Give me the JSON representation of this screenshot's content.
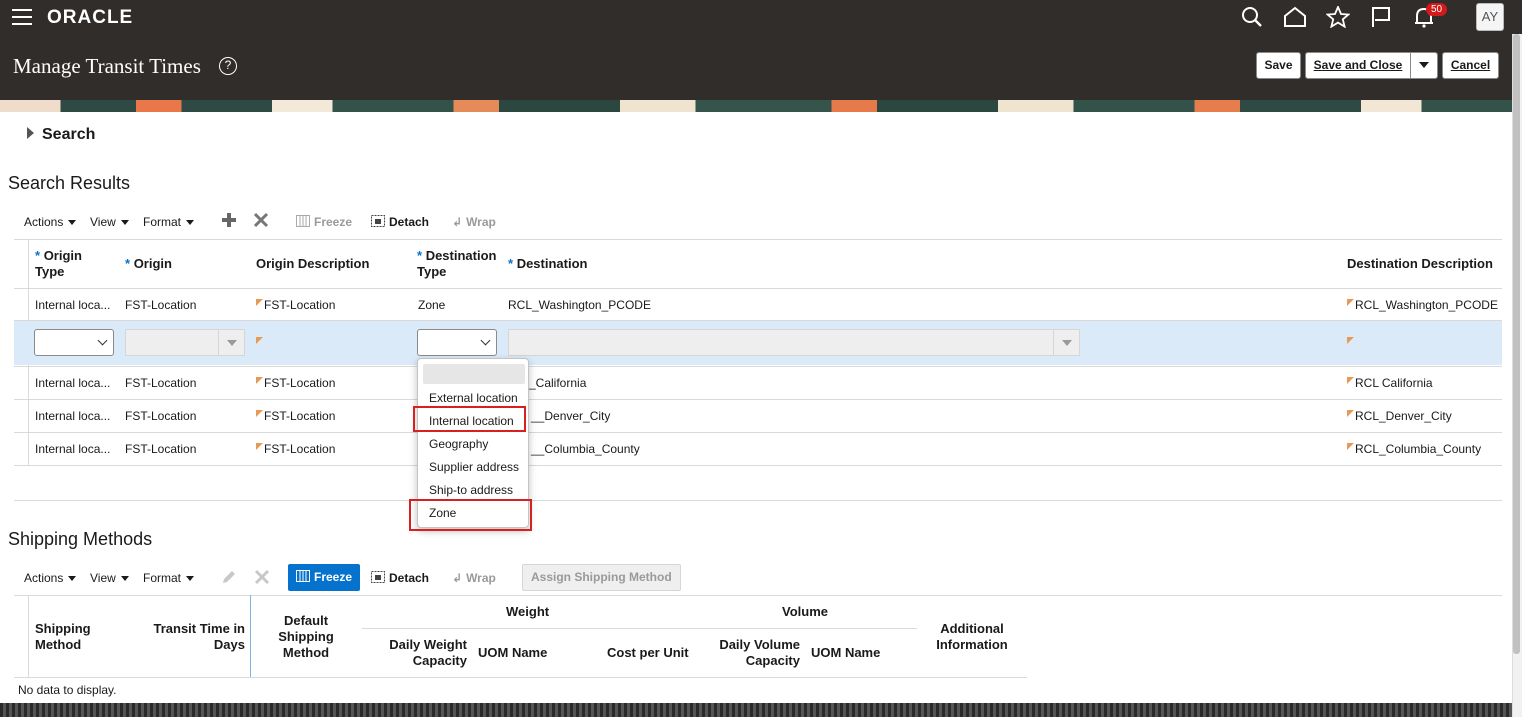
{
  "header": {
    "brand": "ORACLE",
    "page_title": "Manage Transit Times",
    "notifications_count": "50",
    "avatar_initials": "AY",
    "save_label": "Save",
    "save_close_label": "Save and Close",
    "cancel_label": "Cancel"
  },
  "search": {
    "label": "Search"
  },
  "search_results": {
    "title": "Search Results",
    "toolbar": {
      "actions": "Actions",
      "view": "View",
      "format": "Format",
      "freeze": "Freeze",
      "detach": "Detach",
      "wrap": "Wrap"
    },
    "columns": {
      "origin_type_1": "Origin",
      "origin_type_2": "Type",
      "origin": "Origin",
      "origin_description": "Origin Description",
      "destination_type_1": "Destination",
      "destination_type_2": "Type",
      "destination": "Destination",
      "destination_description": "Destination Description"
    },
    "rows": [
      {
        "origin_type": "Internal loca...",
        "origin": "FST-Location",
        "origin_description": "FST-Location",
        "destination_type": "Zone",
        "destination": "RCL_Washington_PCODE",
        "destination_description": "RCL_Washington_PCODE"
      },
      {
        "origin_type": "",
        "origin": "",
        "origin_description": "",
        "destination_type": "",
        "destination": "",
        "destination_description": ""
      },
      {
        "origin_type": "Internal loca...",
        "origin": "FST-Location",
        "origin_description": "FST-Location",
        "destination_type": "",
        "destination": "_California",
        "destination_description": "RCL California"
      },
      {
        "origin_type": "Internal loca...",
        "origin": "FST-Location",
        "origin_description": "FST-Location",
        "destination_type": "",
        "destination": "__Denver_City",
        "destination_description": "RCL_Denver_City"
      },
      {
        "origin_type": "Internal loca...",
        "origin": "FST-Location",
        "origin_description": "FST-Location",
        "destination_type": "",
        "destination": "__Columbia_County",
        "destination_description": "RCL_Columbia_County"
      }
    ]
  },
  "destination_type_dropdown": {
    "options": [
      "",
      "External location",
      "Internal location",
      "Geography",
      "Supplier address",
      "Ship-to address",
      "Zone"
    ]
  },
  "shipping_methods": {
    "title": "Shipping Methods",
    "toolbar": {
      "actions": "Actions",
      "view": "View",
      "format": "Format",
      "freeze": "Freeze",
      "detach": "Detach",
      "wrap": "Wrap",
      "assign": "Assign Shipping Method"
    },
    "columns": {
      "shipping_method_1": "Shipping",
      "shipping_method_2": "Method",
      "transit_time_1": "Transit Time in",
      "transit_time_2": "Days",
      "default_method_1": "Default",
      "default_method_2": "Shipping",
      "default_method_3": "Method",
      "weight_group": "Weight",
      "daily_weight_1": "Daily Weight",
      "daily_weight_2": "Capacity",
      "weight_uom": "UOM Name",
      "cost_per_unit": "Cost per Unit",
      "volume_group": "Volume",
      "daily_volume_1": "Daily Volume",
      "daily_volume_2": "Capacity",
      "volume_uom": "UOM Name",
      "additional_1": "Additional",
      "additional_2": "Information"
    },
    "empty_text": "No data to display."
  }
}
